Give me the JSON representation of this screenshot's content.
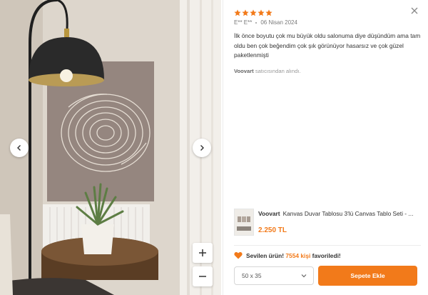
{
  "review": {
    "rating": 5,
    "author": "E** E**",
    "date": "06 Nisan 2024",
    "text": "İlk önce boyutu çok mu büyük oldu salonuma diye düşündüm ama tam oldu ben çok beğendim çok şık görünüyor hasarsız ve çok güzel paketlenmişti",
    "seller_name": "Voovart",
    "seller_suffix": "satıcısından alındı."
  },
  "product": {
    "brand": "Voovart",
    "title": "Kanvas Duvar Tablosu 3'lü Canvas Tablo Seti - ...",
    "price": "2.250 TL"
  },
  "favorites": {
    "prefix": "Sevilen ürün!",
    "count_text": "7554 kişi",
    "suffix": "favoriledi!"
  },
  "size_select": {
    "value": "50 x 35"
  },
  "cart_button": {
    "label": "Sepete Ekle"
  },
  "colors": {
    "accent": "#f27a1a",
    "star": "#f27a1a"
  },
  "icons": [
    "chevron-left-icon",
    "chevron-right-icon",
    "plus-icon",
    "minus-icon",
    "close-icon",
    "star-icon",
    "heart-icon",
    "chevron-down-icon"
  ]
}
